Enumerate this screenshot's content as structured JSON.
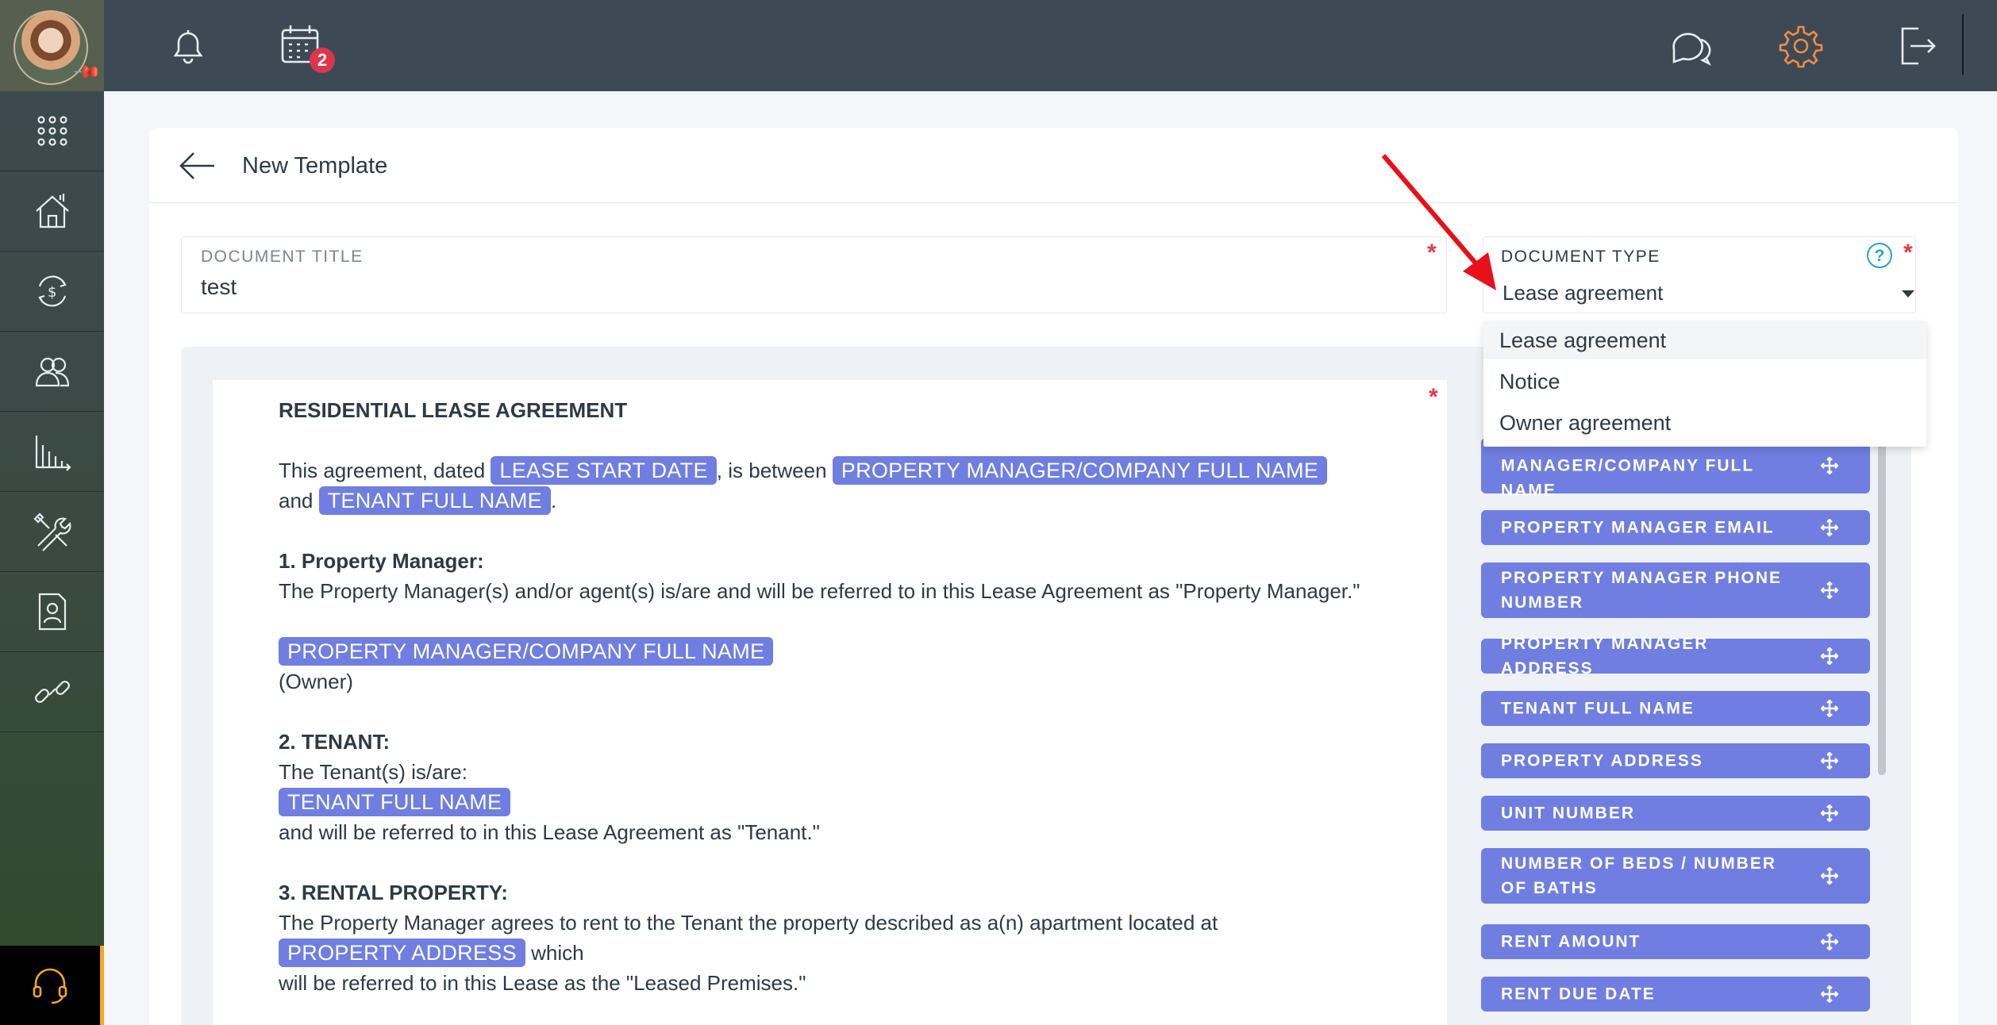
{
  "topbar": {
    "calendar_badge": "2",
    "icons": [
      "bell-icon",
      "calendar-icon",
      "chat-icon",
      "gear-icon",
      "logout-icon"
    ],
    "accent": "#f08c43"
  },
  "sidebar": {
    "items": [
      "apps-icon",
      "properties-icon",
      "payments-icon",
      "contacts-icon",
      "reports-icon",
      "tools-icon",
      "documents-icon",
      "links-icon"
    ],
    "support_icon": "headset-icon"
  },
  "header": {
    "title": "New Template"
  },
  "form": {
    "document_title": {
      "label": "DOCUMENT TITLE",
      "value": "test",
      "required_mark": "*"
    },
    "document_type": {
      "label": "DOCUMENT TYPE",
      "help": "?",
      "value": "Lease agreement",
      "required_mark": "*",
      "options": [
        "Lease agreement",
        "Notice",
        "Owner agreement"
      ]
    }
  },
  "editor": {
    "required_mark": "*",
    "heading": "RESIDENTIAL LEASE AGREEMENT",
    "p1_a": "This agreement, dated ",
    "chip_lease_start": "LEASE START DATE",
    "p1_b": ", is between ",
    "chip_pm_full": "PROPERTY MANAGER/COMPANY FULL NAME",
    "p1_c": " and ",
    "chip_tenant": "TENANT FULL NAME",
    "p1_d": ".",
    "s1_title": "1. Property Manager:",
    "s1_text": "The Property Manager(s) and/or agent(s) is/are and will be referred to in this Lease Agreement as \"Property Manager.\"",
    "s1_chip": "PROPERTY MANAGER/COMPANY FULL NAME",
    "s1_owner": "(Owner)",
    "s2_title": "2. TENANT:",
    "s2_text": "The Tenant(s) is/are:",
    "s2_chip": "TENANT FULL NAME",
    "s2_after": "and will be referred to in this Lease Agreement as \"Tenant.\"",
    "s3_title": "3. RENTAL PROPERTY:",
    "s3_text": "The Property Manager agrees to rent to the Tenant the property described as a(n) apartment located at",
    "s3_chip": "PROPERTY ADDRESS",
    "s3_which": " which",
    "s3_after": "will be referred to in this Lease as the \"Leased Premises.\""
  },
  "variables": [
    "PROPERTY MANAGER/COMPANY FULL NAME",
    "PROPERTY MANAGER EMAIL",
    "PROPERTY MANAGER PHONE NUMBER",
    "PROPERTY MANAGER ADDRESS",
    "TENANT FULL NAME",
    "PROPERTY ADDRESS",
    "UNIT NUMBER",
    "NUMBER OF BEDS / NUMBER OF BATHS",
    "RENT AMOUNT",
    "RENT DUE DATE"
  ]
}
